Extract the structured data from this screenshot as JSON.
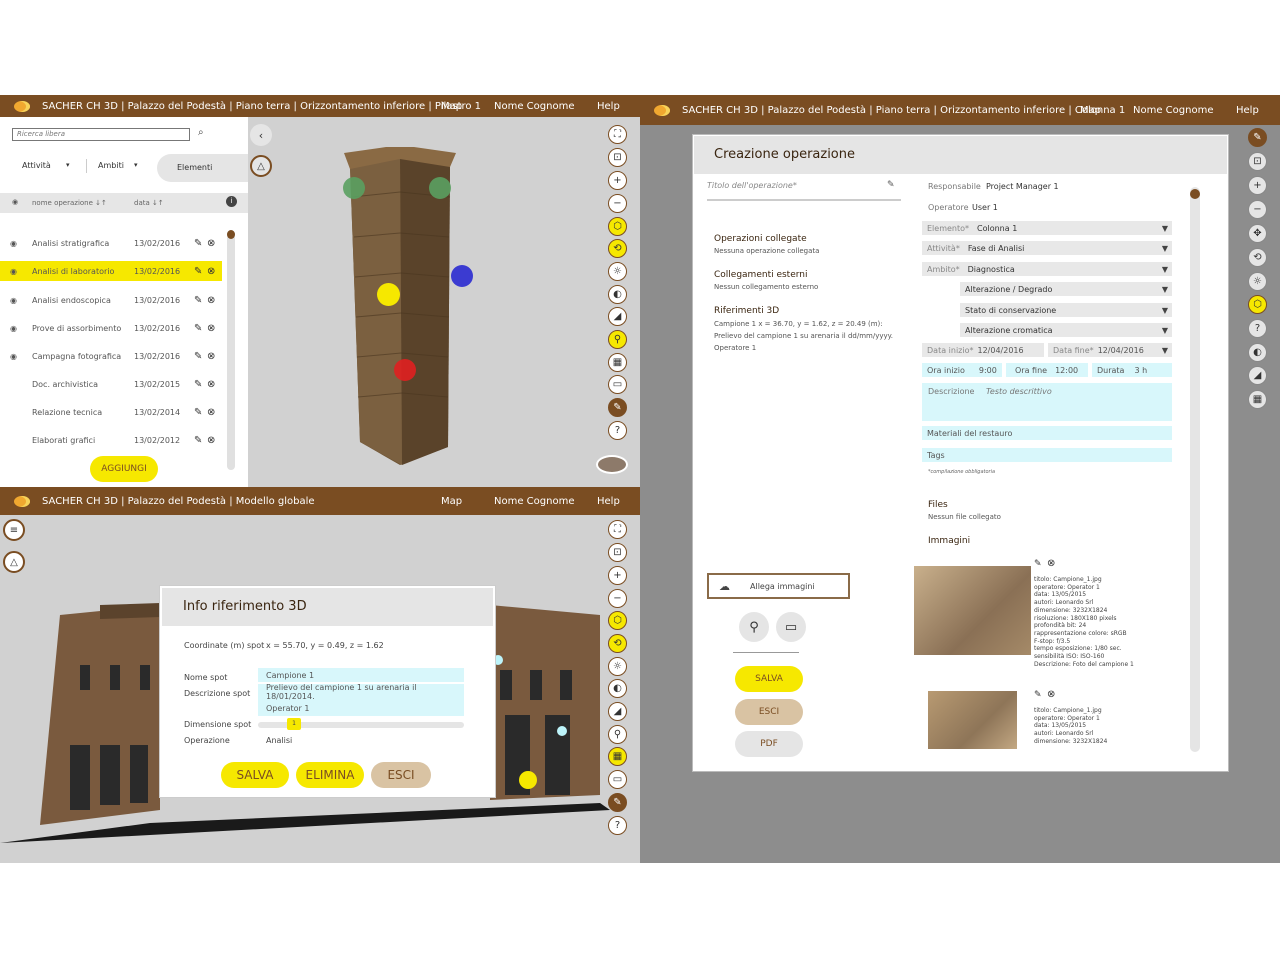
{
  "colors": {
    "brand": "#7a4d22",
    "accent": "#f6e800",
    "field": "#d8f7fb",
    "viewport": "#d1d1d1",
    "backdrop": "#8d8d8d"
  },
  "topleft": {
    "title": "SACHER CH 3D | Palazzo del Podestà | Piano terra | Orizzontamento inferiore | Pilastro 1",
    "map": "Map",
    "user": "Nome Cognome",
    "help": "Help",
    "search_placeholder": "Ricerca libera",
    "filters": {
      "attivita": "Attività",
      "ambiti": "Ambiti",
      "elementi": "Elementi"
    },
    "columns": {
      "name": "nome operazione",
      "date": "data"
    },
    "rows": [
      {
        "name": "Analisi stratigrafica",
        "date": "13/02/2016"
      },
      {
        "name": "Analisi di laboratorio",
        "date": "13/02/2016"
      },
      {
        "name": "Analisi endoscopica",
        "date": "13/02/2016"
      },
      {
        "name": "Prove di assorbimento",
        "date": "13/02/2016"
      },
      {
        "name": "Campagna fotografica",
        "date": "13/02/2016"
      },
      {
        "name": "Doc. archivistica",
        "date": "13/02/2015"
      },
      {
        "name": "Relazione tecnica",
        "date": "13/02/2014"
      },
      {
        "name": "Elaborati grafici",
        "date": "13/02/2012"
      }
    ],
    "add_label": "AGGIUNGI"
  },
  "bottomleft": {
    "title": "SACHER CH 3D | Palazzo del Podestà | Modello globale",
    "map": "Map",
    "user": "Nome Cognome",
    "help": "Help",
    "dialog": {
      "title": "Info riferimento 3D",
      "coord_label": "Coordinate (m) spot",
      "coord_value": "x = 55.70, y = 0.49, z = 1.62",
      "name_label": "Nome spot",
      "name_value": "Campione 1",
      "desc_label": "Descrizione spot",
      "desc_value": "Prelievo del campione 1 su arenaria il 18/01/2014.",
      "operator_value": "Operator 1",
      "size_label": "Dimensione spot",
      "size_value": "1",
      "op_label": "Operazione",
      "op_value": "Analisi",
      "save": "SALVA",
      "delete": "ELIMINA",
      "exit": "ESCI"
    }
  },
  "right": {
    "title": "SACHER CH 3D | Palazzo del Podestà | Piano terra | Orizzontamento inferiore | Colonna 1",
    "map": "Map",
    "user": "Nome Cognome",
    "help": "Help",
    "form": {
      "heading": "Creazione operazione",
      "title_placeholder": "Titolo dell'operazione*",
      "linked_ops_title": "Operazioni collegate",
      "linked_ops_text": "Nessuna operazione collegata",
      "external_title": "Collegamenti esterni",
      "external_text": "Nessun collegamento esterno",
      "refs_title": "Riferimenti 3D",
      "refs_line1": "Campione 1 x = 36.70, y = 1.62, z = 20.49 (m):",
      "refs_line2": "Prelievo del campione 1 su arenaria il dd/mm/yyyy.",
      "refs_line3": "Operatore 1",
      "responsabile_label": "Responsabile",
      "responsabile_value": "Project Manager 1",
      "operatore_label": "Operatore",
      "operatore_value": "User 1",
      "elemento_label": "Elemento*",
      "elemento_value": "Colonna 1",
      "attivita_label": "Attività*",
      "attivita_value": "Fase di Analisi",
      "ambito_label": "Ambito*",
      "ambito_value": "Diagnostica",
      "sub1": "Alterazione / Degrado",
      "sub2": "Stato di conservazione",
      "sub3": "Alterazione cromatica",
      "data_inizio_label": "Data inizio*",
      "data_inizio_value": "12/04/2016",
      "data_fine_label": "Data fine*",
      "data_fine_value": "12/04/2016",
      "ora_inizio_label": "Ora inizio",
      "ora_inizio_value": "9:00",
      "ora_fine_label": "Ora fine",
      "ora_fine_value": "12:00",
      "durata_label": "Durata",
      "durata_value": "3 h",
      "descrizione_label": "Descrizione",
      "descrizione_placeholder": "Testo descrittivo",
      "materiali_label": "Materiali del restauro",
      "tags_label": "Tags",
      "required_note": "*compilazione obbligatoria",
      "files_title": "Files",
      "files_text": "Nessun file collegato",
      "images_title": "Immagini",
      "attach_label": "Allega immagini",
      "save": "SALVA",
      "exit": "ESCI",
      "pdf": "PDF",
      "image1_meta": [
        "titolo: Campione_1.jpg",
        "operatore: Operator 1",
        "data: 13/05/2015",
        "autori: Leonardo Srl",
        "dimensione: 3232X1824",
        "risoluzione: 180X180 pixels",
        "profondità bit: 24",
        "rappresentazione colore: sRGB",
        "F-stop: f/3.5",
        "tempo esposizione: 1/80 sec.",
        "sensibilità ISO: ISO-160",
        "Descrizione: Foto del campione 1"
      ],
      "image2_meta": [
        "titolo: Campione_1.jpg",
        "operatore: Operator 1",
        "data: 13/05/2015",
        "autori: Leonardo Srl",
        "dimensione: 3232X1824"
      ]
    }
  }
}
